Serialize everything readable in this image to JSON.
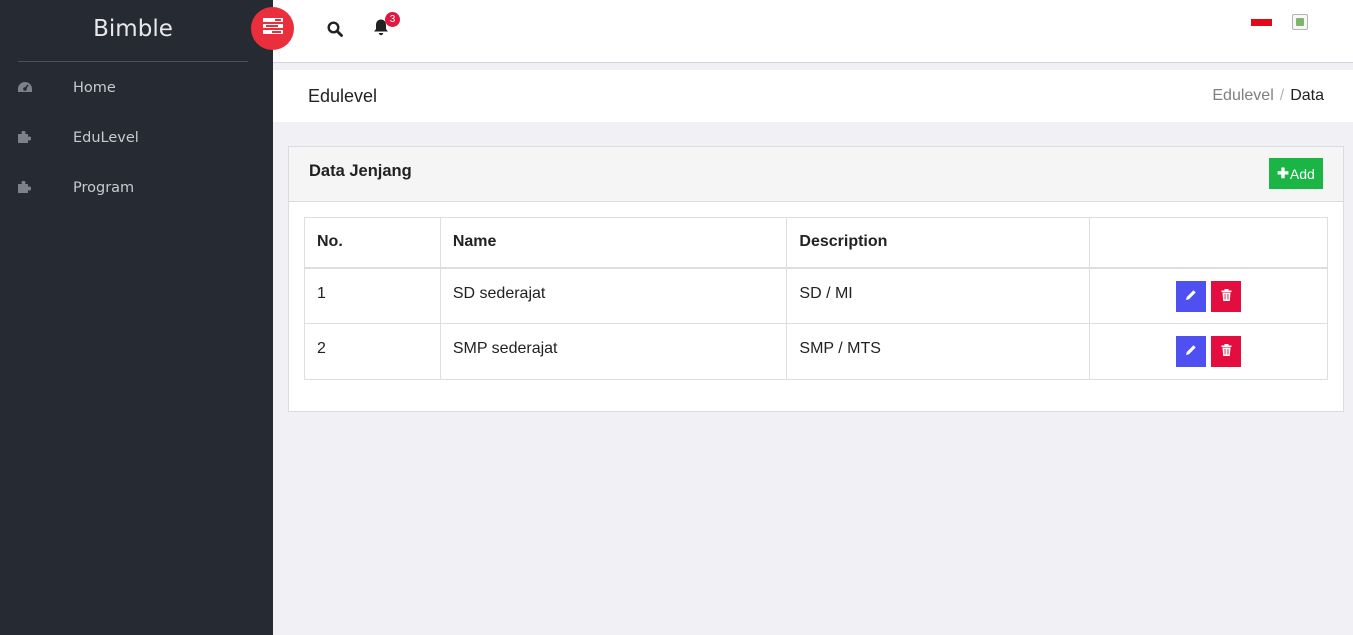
{
  "app": {
    "brand": "Bimble"
  },
  "sidebar": {
    "items": [
      {
        "label": "Home",
        "icon": "dashboard-icon"
      },
      {
        "label": "EduLevel",
        "icon": "puzzle-icon"
      },
      {
        "label": "Program",
        "icon": "puzzle-icon"
      }
    ]
  },
  "topbar": {
    "notification_count": "3",
    "icons": [
      "menu-toggle-icon",
      "search-icon",
      "bell-icon",
      "language-flag",
      "user-avatar"
    ]
  },
  "page": {
    "title": "Edulevel",
    "breadcrumb": {
      "parent": "Edulevel",
      "separator": "/",
      "current": "Data"
    }
  },
  "card": {
    "title": "Data Jenjang",
    "add_label": "Add"
  },
  "table": {
    "headers": [
      "No.",
      "Name",
      "Description",
      ""
    ],
    "rows": [
      {
        "no": "1",
        "name": "SD sederajat",
        "description": "SD / MI"
      },
      {
        "no": "2",
        "name": "SMP sederajat",
        "description": "SMP / MTS"
      }
    ]
  },
  "colors": {
    "sidebar_bg": "#262a33",
    "accent_red": "#ea2e3b",
    "add_green": "#1bb546",
    "edit_blue": "#4f50f2",
    "delete_red": "#e30d3f"
  }
}
